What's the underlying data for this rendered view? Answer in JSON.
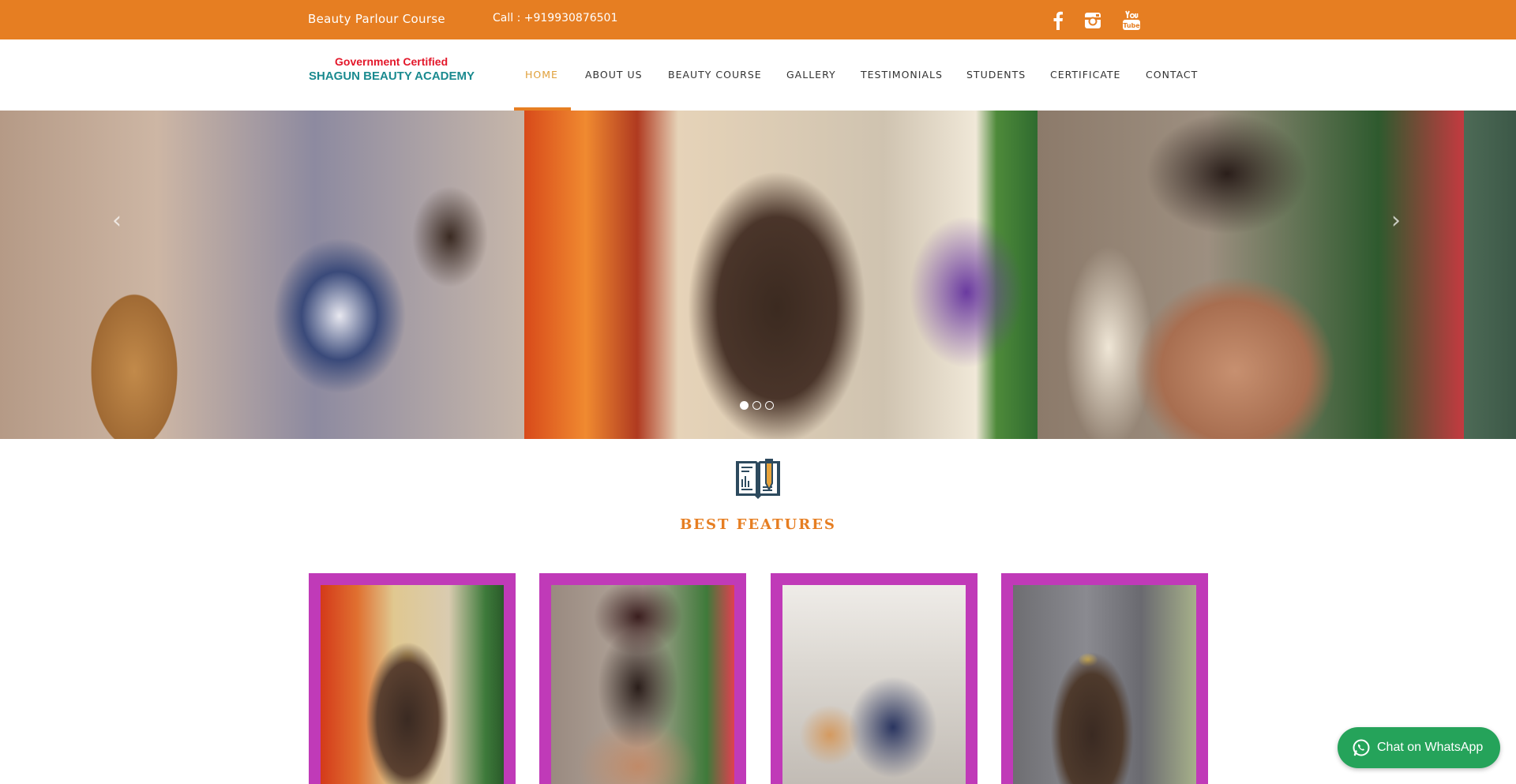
{
  "topbar": {
    "course": "Beauty Parlour Course",
    "call": "Call : +919930876501",
    "social": [
      "facebook-icon",
      "instagram-icon",
      "youtube-icon"
    ]
  },
  "logo": {
    "certified": "Government Certified",
    "name": "SHAGUN BEAUTY ACADEMY"
  },
  "nav": {
    "items": [
      "HOME",
      "ABOUT US",
      "BEAUTY COURSE",
      "GALLERY",
      "TESTIMONIALS",
      "STUDENTS",
      "CERTIFICATE",
      "CONTACT"
    ],
    "active": "HOME"
  },
  "slider": {
    "prev_icon": "chevron-left-icon",
    "next_icon": "chevron-right-icon",
    "slide_count": 3,
    "current_slide": 1
  },
  "features": {
    "icon": "book-pencil-icon",
    "title": "BEST FEATURES"
  },
  "whatsapp": {
    "label": "Chat on WhatsApp",
    "icon": "whatsapp-icon"
  },
  "colors": {
    "accent_orange": "#e67e22",
    "nav_active": "#e0a03a",
    "card_frame": "#c03ab8",
    "logo_red": "#e3172a",
    "logo_teal": "#1a8a8f",
    "whatsapp_green": "#25a35a"
  }
}
